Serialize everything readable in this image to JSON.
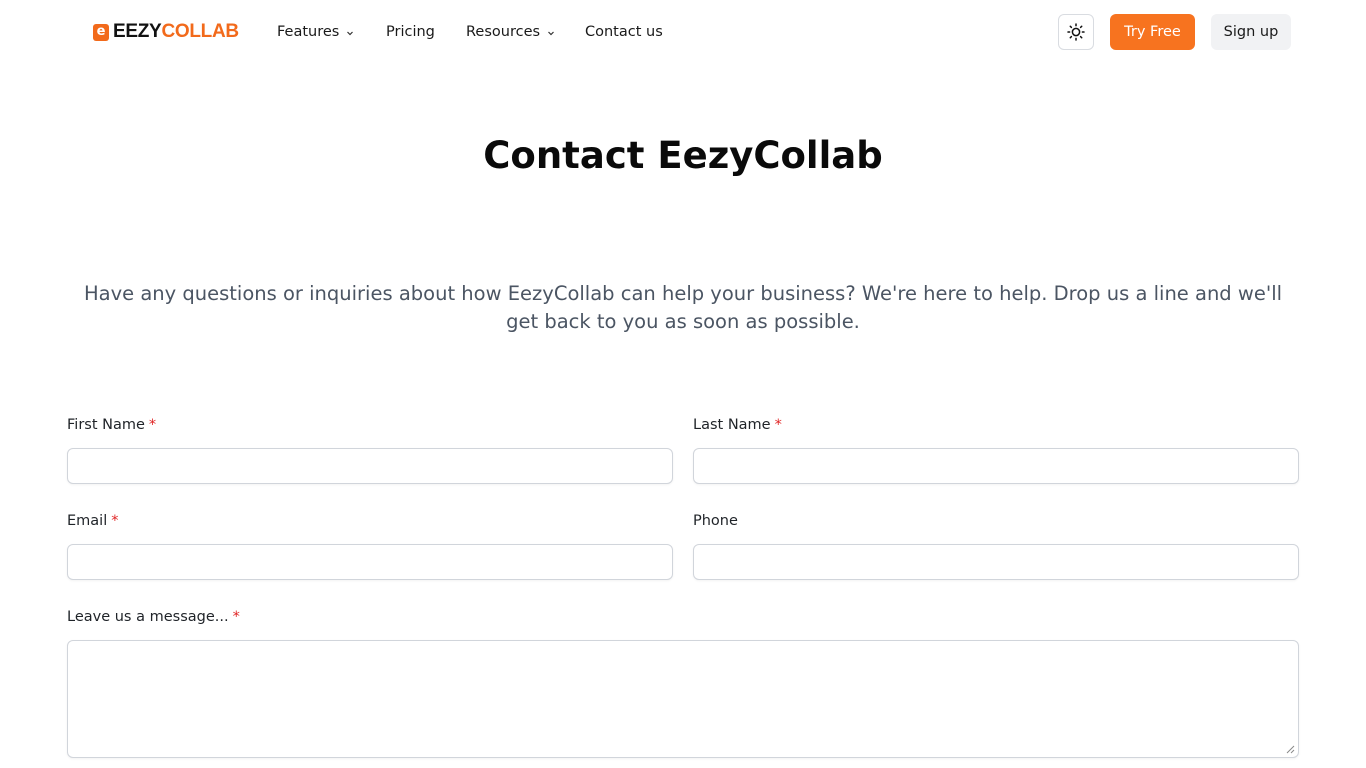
{
  "brand": {
    "logo_mark": "e",
    "name_dark": "EEZY",
    "name_accent": "COLLAB",
    "accent_color": "#f26a1b"
  },
  "nav": {
    "items": [
      {
        "label": "Features",
        "has_dropdown": true
      },
      {
        "label": "Pricing",
        "has_dropdown": false
      },
      {
        "label": "Resources",
        "has_dropdown": true
      },
      {
        "label": "Contact us",
        "has_dropdown": false
      }
    ],
    "theme_toggle_icon": "sun-icon",
    "try_free_label": "Try Free",
    "try_free_color": "#f7731f",
    "sign_up_label": "Sign up"
  },
  "hero": {
    "title": "Contact EezyCollab",
    "subtitle": "Have any questions or inquiries about how EezyCollab can help your business? We're here to help. Drop us a line and we'll get back to you as soon as possible."
  },
  "form": {
    "first_name": {
      "label": "First Name",
      "required_mark": "*",
      "value": ""
    },
    "last_name": {
      "label": "Last Name",
      "required_mark": "*",
      "value": ""
    },
    "email": {
      "label": "Email",
      "required_mark": "*",
      "value": ""
    },
    "phone": {
      "label": "Phone",
      "value": ""
    },
    "message": {
      "label": "Leave us a message...",
      "required_mark": "*",
      "value": ""
    },
    "required_color": "#e02424"
  }
}
